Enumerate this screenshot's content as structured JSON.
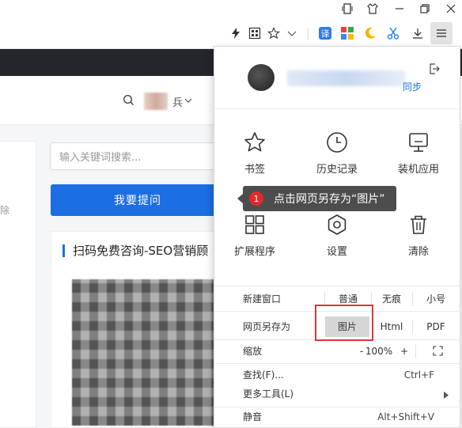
{
  "toolbar": {
    "icons": [
      "tablet-icon",
      "shirt-icon",
      "restore-icon",
      "close-icon",
      "lightning-icon",
      "qr-code-icon",
      "star-icon",
      "chevron-down-icon",
      "translate-icon",
      "apps-icon",
      "moon-icon",
      "scissors-icon",
      "download-icon",
      "menu-icon"
    ]
  },
  "page": {
    "search_placeholder": "输入关键词搜索...",
    "ask_button": "我要提问",
    "promo_title": "扫码免费咨询-SEO营销顾",
    "user_suffix": "兵",
    "left_fragment": "除"
  },
  "menu": {
    "sync_text": "同步",
    "tiles": [
      {
        "label": "书签",
        "icon": "star-icon"
      },
      {
        "label": "历史记录",
        "icon": "clock-icon"
      },
      {
        "label": "装机应用",
        "icon": "monitor-icon"
      },
      {
        "label": "扩展程序",
        "icon": "grid-icon"
      },
      {
        "label": "设置",
        "icon": "gear-icon"
      },
      {
        "label": "清除",
        "icon": "trash-icon"
      }
    ],
    "tooltip": {
      "badge": "1",
      "text": "点击网页另存为“图片”"
    },
    "new_window": {
      "label": "新建窗口",
      "options": [
        "普通",
        "无痕",
        "小号"
      ]
    },
    "save_as": {
      "label": "网页另存为",
      "options": [
        "图片",
        "Html",
        "PDF"
      ]
    },
    "zoom": {
      "label": "缩放",
      "minus": "-",
      "value": "100%",
      "plus": "+"
    },
    "find": {
      "label": "查找(F)...",
      "shortcut": "Ctrl+F"
    },
    "more_tools": {
      "label": "更多工具(L)"
    },
    "mute": {
      "label": "静音",
      "shortcut": "Alt+Shift+V"
    }
  },
  "colors": {
    "accent": "#1c6ee3",
    "highlight": "#d9363e",
    "tooltip_bg": "#4d4d4d",
    "badge": "#e02b2b"
  }
}
